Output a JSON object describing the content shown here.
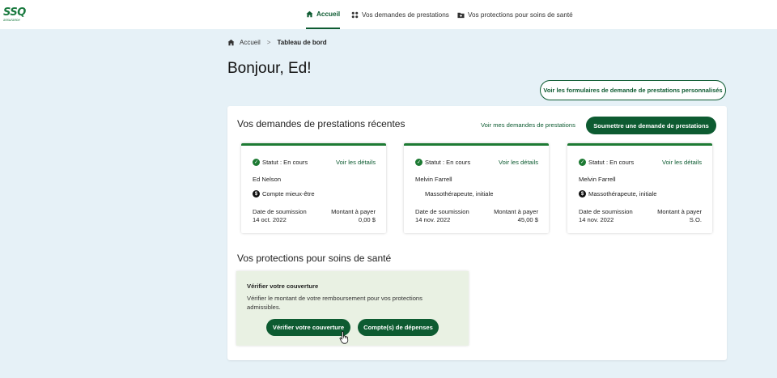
{
  "brand": {
    "logo_text": "SSQ",
    "logo_sub": "assurance",
    "color": "#1a7a3f"
  },
  "nav": {
    "items": [
      {
        "label": "Accueil",
        "icon": "home-icon",
        "active": true
      },
      {
        "label": "Vos demandes de prestations",
        "icon": "grid-icon",
        "active": false
      },
      {
        "label": "Vos protections pour soins de santé",
        "icon": "folder-plus-icon",
        "active": false
      }
    ]
  },
  "breadcrumb": {
    "home": "Accueil",
    "separator": ">",
    "current": "Tableau de bord"
  },
  "greeting": "Bonjour, Ed!",
  "forms_button": "Voir les formulaires de demande de prestations personnalisés",
  "claims": {
    "title": "Vos demandes de prestations récentes",
    "view_all_link": "Voir mes demandes de prestations",
    "submit_button": "Soumettre une demande de prestations",
    "cards": [
      {
        "status": "Statut : En cours",
        "details_link": "Voir les détails",
        "name": "Ed Nelson",
        "service": "Compte mieux-être",
        "service_icon": true,
        "date_label": "Date de soumission",
        "date": "14 oct. 2022",
        "amount_label": "Montant à payer",
        "amount": "0,00 $"
      },
      {
        "status": "Statut : En cours",
        "details_link": "Voir les détails",
        "name": "Melvin Farrell",
        "service": "Massothérapeute, initiale",
        "service_icon": false,
        "date_label": "Date de soumission",
        "date": "14 nov. 2022",
        "amount_label": "Montant à payer",
        "amount": "45,00 $"
      },
      {
        "status": "Statut : En cours",
        "details_link": "Voir les détails",
        "name": "Melvin Farrell",
        "service": "Massothérapeute, initiale",
        "service_icon": true,
        "date_label": "Date de soumission",
        "date": "14 nov. 2022",
        "amount_label": "Montant à payer",
        "amount": "S.O."
      }
    ]
  },
  "coverage": {
    "title": "Vos protections pour soins de santé",
    "box_title": "Vérifier votre couverture",
    "box_desc": "Vérifier le montant de votre remboursement pour vos protections admissibles.",
    "verify_button": "Vérifier votre couverture",
    "accounts_button": "Compte(s) de dépenses"
  },
  "colors": {
    "accent": "#0d5b31",
    "background": "#e6f1f7",
    "card_top": "#1d7a33",
    "coverage_bg": "#e9f1e3"
  }
}
